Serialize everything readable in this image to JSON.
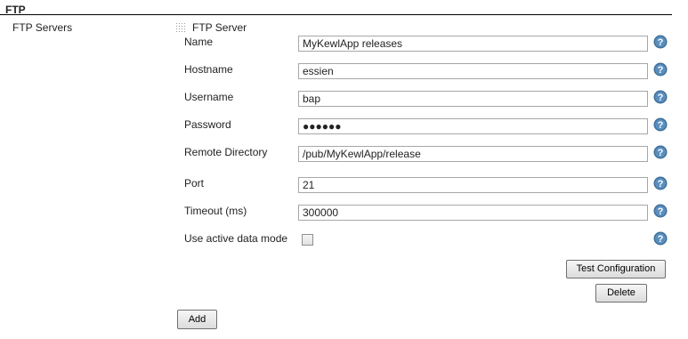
{
  "section": {
    "title": "FTP",
    "servers_label": "FTP Servers"
  },
  "server": {
    "title": "FTP Server",
    "fields": {
      "name": {
        "label": "Name",
        "value": "MyKewlApp releases"
      },
      "hostname": {
        "label": "Hostname",
        "value": "essien"
      },
      "username": {
        "label": "Username",
        "value": "bap"
      },
      "password": {
        "label": "Password",
        "value": "●●●●●●"
      },
      "remote_directory": {
        "label": "Remote Directory",
        "value": "/pub/MyKewlApp/release"
      },
      "port": {
        "label": "Port",
        "value": "21"
      },
      "timeout": {
        "label": "Timeout (ms)",
        "value": "300000"
      },
      "active_mode": {
        "label": "Use active data mode",
        "checked": false
      }
    },
    "test_button": "Test Configuration",
    "delete_button": "Delete"
  },
  "add_button": "Add",
  "icons": {
    "help": "help-icon",
    "drag_handle": "drag-handle-icon"
  },
  "colors": {
    "help_icon": "#3f6f9a",
    "rule": "#000000"
  }
}
